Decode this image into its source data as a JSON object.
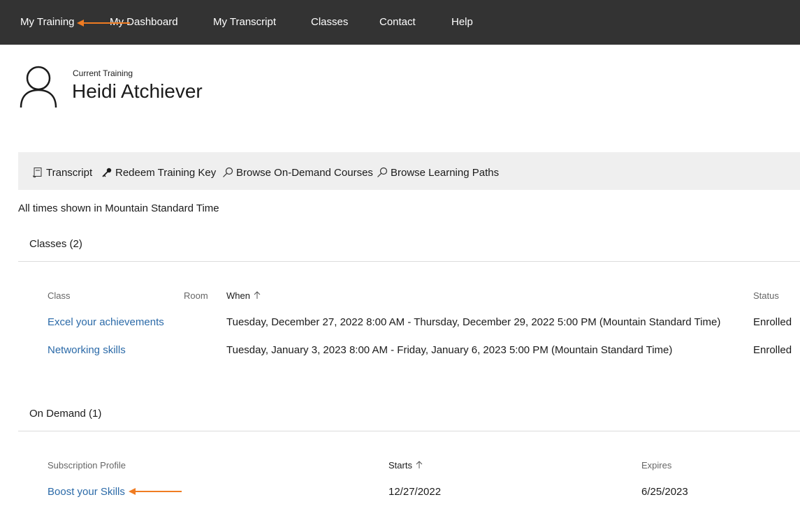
{
  "nav": {
    "my_training": "My Training",
    "my_dashboard": "My Dashboard",
    "my_transcript": "My Transcript",
    "classes": "Classes",
    "contact": "Contact",
    "help": "Help"
  },
  "header": {
    "label": "Current Training",
    "name": "Heidi Atchiever",
    "icon": "user-icon"
  },
  "toolbar": {
    "transcript": "Transcript",
    "redeem": "Redeem Training Key",
    "browse_courses": "Browse On-Demand Courses",
    "browse_paths": "Browse Learning Paths"
  },
  "timezone_note": "All times shown in Mountain Standard Time",
  "classes_section": {
    "title": "Classes (2)",
    "columns": {
      "class": "Class",
      "room": "Room",
      "when": "When",
      "status": "Status"
    },
    "rows": [
      {
        "class": "Excel your achievements",
        "room": "",
        "when": "Tuesday, December 27, 2022 8:00 AM - Thursday, December 29, 2022 5:00 PM (Mountain Standard Time)",
        "status": "Enrolled"
      },
      {
        "class": "Networking skills",
        "room": "",
        "when": "Tuesday, January 3, 2023 8:00 AM - Friday, January 6, 2023 5:00 PM (Mountain Standard Time)",
        "status": "Enrolled"
      }
    ]
  },
  "ondemand_section": {
    "title": "On Demand (1)",
    "columns": {
      "profile": "Subscription Profile",
      "starts": "Starts",
      "expires": "Expires"
    },
    "rows": [
      {
        "profile": "Boost your Skills",
        "starts": "12/27/2022",
        "expires": "6/25/2023"
      }
    ]
  },
  "colors": {
    "nav_bg": "#333333",
    "link": "#2b6aa8",
    "annotation_arrow": "#f07c22",
    "toolbar_bg": "#efefef"
  }
}
